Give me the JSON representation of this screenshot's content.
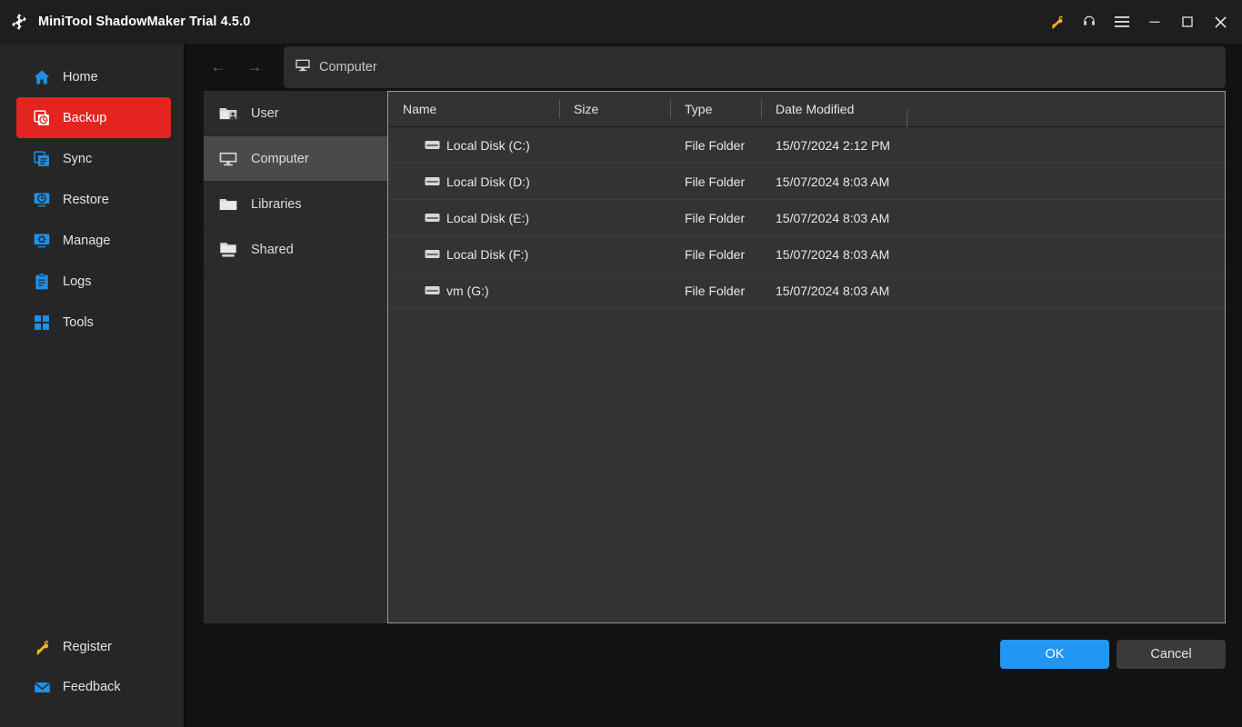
{
  "window": {
    "title": "MiniTool ShadowMaker Trial 4.5.0",
    "logo_icon": "refresh-circular-arrows-logo",
    "controls": [
      {
        "name": "key-icon",
        "label": "Register",
        "color": "#f5b323"
      },
      {
        "name": "headset-icon",
        "label": "Support",
        "color": "#d8d8d8"
      },
      {
        "name": "hamburger-icon",
        "label": "Menu",
        "color": "#d8d8d8"
      },
      {
        "name": "minimize-icon",
        "label": "Minimize",
        "color": "#d8d8d8"
      },
      {
        "name": "maximize-icon",
        "label": "Maximize",
        "color": "#d8d8d8"
      },
      {
        "name": "close-icon",
        "label": "Close",
        "color": "#d8d8d8"
      }
    ]
  },
  "sidebar": {
    "active_index": 1,
    "accent_color": "#e3241f",
    "items": [
      {
        "label": "Home",
        "icon": "home-icon",
        "color": "#1e90e8"
      },
      {
        "label": "Backup",
        "icon": "backup-icon",
        "color": "#ffffff"
      },
      {
        "label": "Sync",
        "icon": "sync-icon",
        "color": "#1e90e8"
      },
      {
        "label": "Restore",
        "icon": "restore-icon",
        "color": "#1e90e8"
      },
      {
        "label": "Manage",
        "icon": "manage-icon",
        "color": "#1e90e8"
      },
      {
        "label": "Logs",
        "icon": "logs-icon",
        "color": "#1e90e8"
      },
      {
        "label": "Tools",
        "icon": "tools-icon",
        "color": "#1e90e8"
      }
    ],
    "bottom_items": [
      {
        "label": "Register",
        "icon": "key-icon",
        "color": "#f5b323"
      },
      {
        "label": "Feedback",
        "icon": "envelope-icon",
        "color": "#1e90e8"
      }
    ]
  },
  "navbar": {
    "back_icon": "arrow-left-icon",
    "forward_icon": "arrow-right-icon",
    "address_icon": "monitor-icon",
    "address_value": "Computer"
  },
  "tree": {
    "selected_index": 1,
    "items": [
      {
        "label": "User",
        "icon": "folder-user-icon"
      },
      {
        "label": "Computer",
        "icon": "monitor-icon"
      },
      {
        "label": "Libraries",
        "icon": "folder-icon"
      },
      {
        "label": "Shared",
        "icon": "shared-folder-icon"
      }
    ]
  },
  "filelist": {
    "columns": [
      "Name",
      "Size",
      "Type",
      "Date Modified"
    ],
    "rows": [
      {
        "name": "Local Disk (C:)",
        "size": "",
        "type": "File Folder",
        "date": "15/07/2024 2:12 PM",
        "icon": "drive-icon"
      },
      {
        "name": "Local Disk (D:)",
        "size": "",
        "type": "File Folder",
        "date": "15/07/2024 8:03 AM",
        "icon": "drive-icon"
      },
      {
        "name": "Local Disk (E:)",
        "size": "",
        "type": "File Folder",
        "date": "15/07/2024 8:03 AM",
        "icon": "drive-icon"
      },
      {
        "name": "Local Disk (F:)",
        "size": "",
        "type": "File Folder",
        "date": "15/07/2024 8:03 AM",
        "icon": "drive-icon"
      },
      {
        "name": "vm (G:)",
        "size": "",
        "type": "File Folder",
        "date": "15/07/2024 8:03 AM",
        "icon": "drive-icon"
      }
    ]
  },
  "footer": {
    "ok_label": "OK",
    "cancel_label": "Cancel",
    "ok_color": "#2196f3"
  }
}
